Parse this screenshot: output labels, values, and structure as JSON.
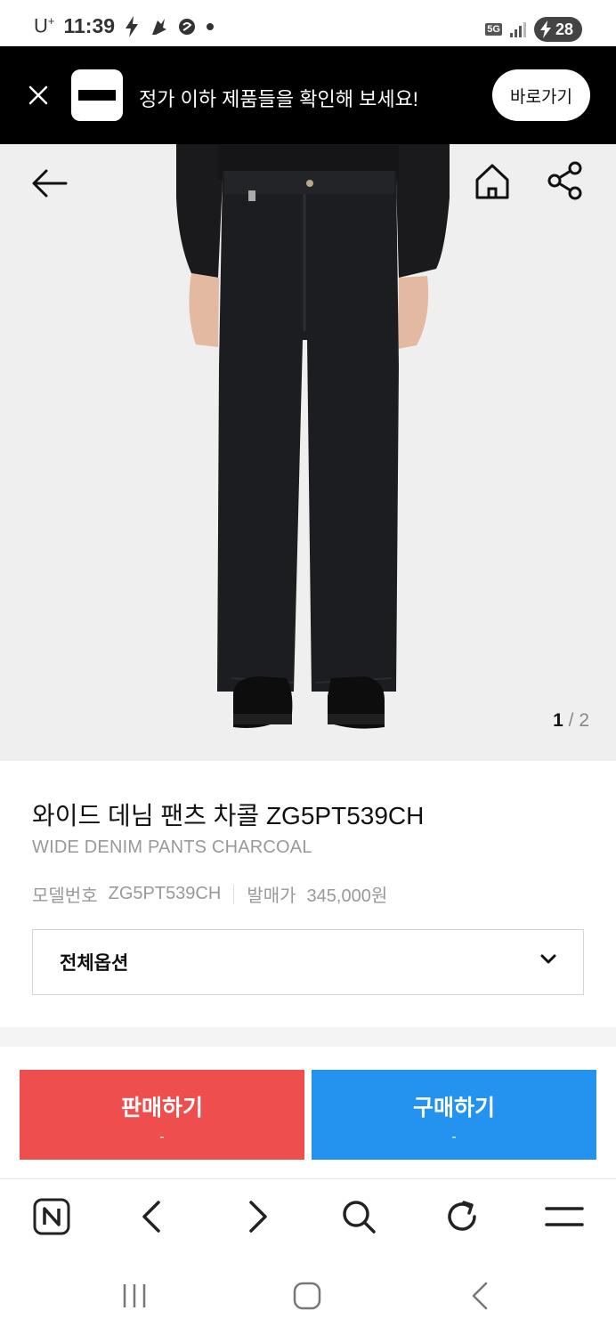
{
  "status_bar": {
    "carrier": "U",
    "carrier_sup": "+",
    "time": "11:39",
    "network": "5G",
    "battery": "28"
  },
  "banner": {
    "message": "정가 이하 제품들을 확인해 보세요!",
    "button_label": "바로가기"
  },
  "gallery": {
    "current": "1",
    "separator": "/",
    "total": "2"
  },
  "product": {
    "name": "와이드 데님 팬츠 차콜 ZG5PT539CH",
    "english_name": "WIDE DENIM PANTS CHARCOAL",
    "model_label": "모델번호",
    "model_value": "ZG5PT539CH",
    "price_label": "발매가",
    "price_value": "345,000원"
  },
  "option": {
    "selected": "전체옵션"
  },
  "actions": {
    "sell_label": "판매하기",
    "sell_price": "-",
    "buy_label": "구매하기",
    "buy_price": "-"
  },
  "colors": {
    "sell": "#ef4e4e",
    "buy": "#2493f0",
    "banner_bg": "#000000"
  },
  "icons": [
    "close-icon",
    "back-arrow-icon",
    "home-icon",
    "share-icon",
    "chevron-down-icon",
    "naver-icon",
    "browser-back-icon",
    "browser-forward-icon",
    "search-icon",
    "refresh-icon",
    "menu-icon",
    "recent-apps-icon",
    "home-button-icon",
    "system-back-icon"
  ]
}
